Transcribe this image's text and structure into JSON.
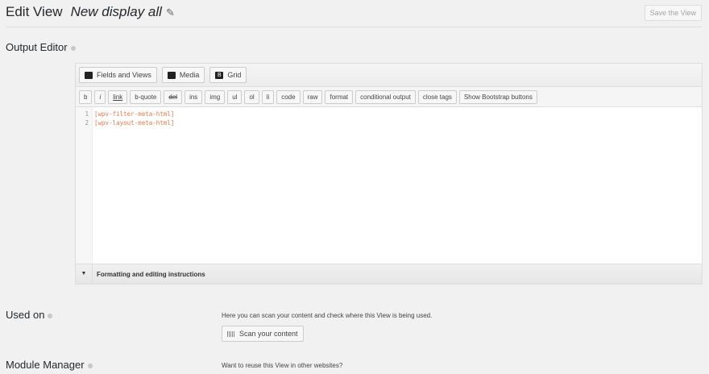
{
  "header": {
    "title": "Edit View",
    "view_name": "New display all",
    "save_label": "Save the View"
  },
  "output_editor": {
    "label": "Output Editor",
    "toolbar_main": [
      "Fields and Views",
      "Media",
      "Grid"
    ],
    "toolbar_format": [
      "b",
      "i",
      "link",
      "b-quote",
      "del",
      "ins",
      "img",
      "ul",
      "ol",
      "li",
      "code",
      "raw",
      "format",
      "conditional output",
      "close tags",
      "Show Bootstrap buttons"
    ],
    "lines": [
      "[wpv-filter-meta-html]",
      "[wpv-layout-meta-html]"
    ],
    "instructions_label": "Formatting and editing instructions"
  },
  "used_on": {
    "label": "Used on",
    "description": "Here you can scan your content and check where this View is being used.",
    "scan_label": "Scan your content"
  },
  "module_manager": {
    "label": "Module Manager",
    "description": "Want to reuse this View in other websites?"
  }
}
